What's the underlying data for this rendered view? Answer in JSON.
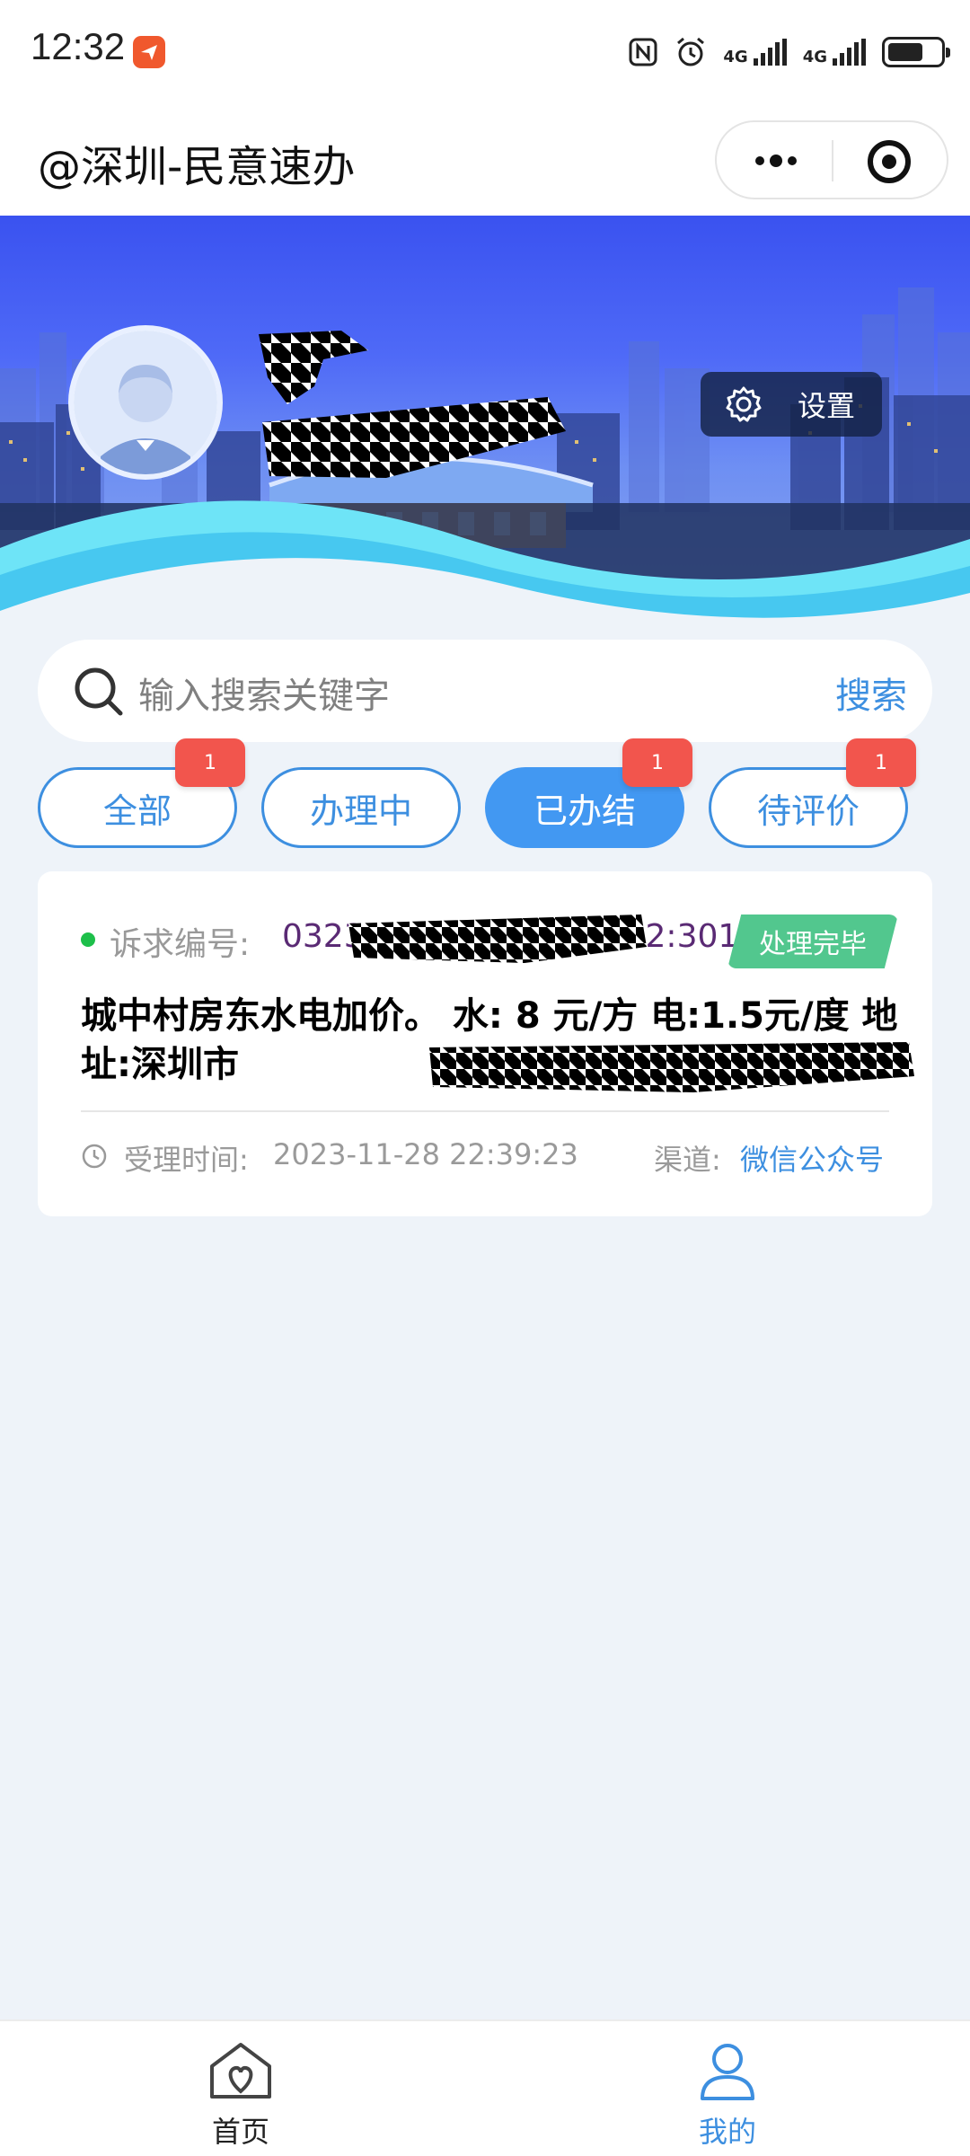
{
  "status_bar": {
    "time": "12:32",
    "network_1": "4G",
    "network_2": "4G"
  },
  "nav": {
    "title": "@深圳-民意速办"
  },
  "profile": {
    "settings_label": "设置"
  },
  "search": {
    "placeholder": "输入搜索关键字",
    "button_label": "搜索"
  },
  "tabs": [
    {
      "label": "全部",
      "badge": "1",
      "active": false
    },
    {
      "label": "办理中",
      "badge": "",
      "active": false
    },
    {
      "label": "已办结",
      "badge": "1",
      "active": true
    },
    {
      "label": "待评价",
      "badge": "1",
      "active": false
    }
  ],
  "record": {
    "case_label": "诉求编号:",
    "case_number_start": "0323",
    "case_number_end": "22:30101",
    "status": "处理完毕",
    "content": "城中村房东水电加价。 水:  8 元/方 电:1.5元/度 地址:深圳市",
    "time_label": "受理时间:",
    "time_value": "2023-11-28 22:39:23",
    "channel_label": "渠道:",
    "channel_value": "微信公众号"
  },
  "bottom_tabs": [
    {
      "label": "首页",
      "icon": "home-icon"
    },
    {
      "label": "我的",
      "icon": "profile-icon"
    }
  ],
  "colors": {
    "accent": "#3d8fe0",
    "badge": "#f2554d",
    "done": "#52c78e",
    "case_number": "#5a2a74"
  }
}
